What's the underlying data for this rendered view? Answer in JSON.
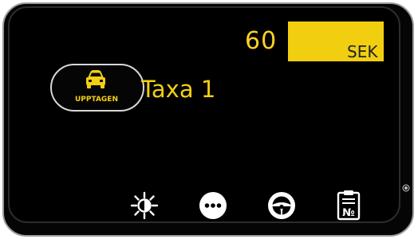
{
  "meter": {
    "fare": "60",
    "currency": "SEK"
  },
  "status": {
    "label": "UPPTAGEN",
    "icon": "car-icon"
  },
  "tariff": {
    "label": "Taxa 1"
  },
  "toolbar": {
    "items": [
      {
        "icon": "brightness-icon"
      },
      {
        "icon": "more-icon"
      },
      {
        "icon": "steering-wheel-icon"
      },
      {
        "icon": "receipt-number-icon",
        "glyph": "№"
      }
    ]
  },
  "colors": {
    "accent": "#f2cf12",
    "background": "#000000",
    "frame": "#9c9c9c"
  }
}
